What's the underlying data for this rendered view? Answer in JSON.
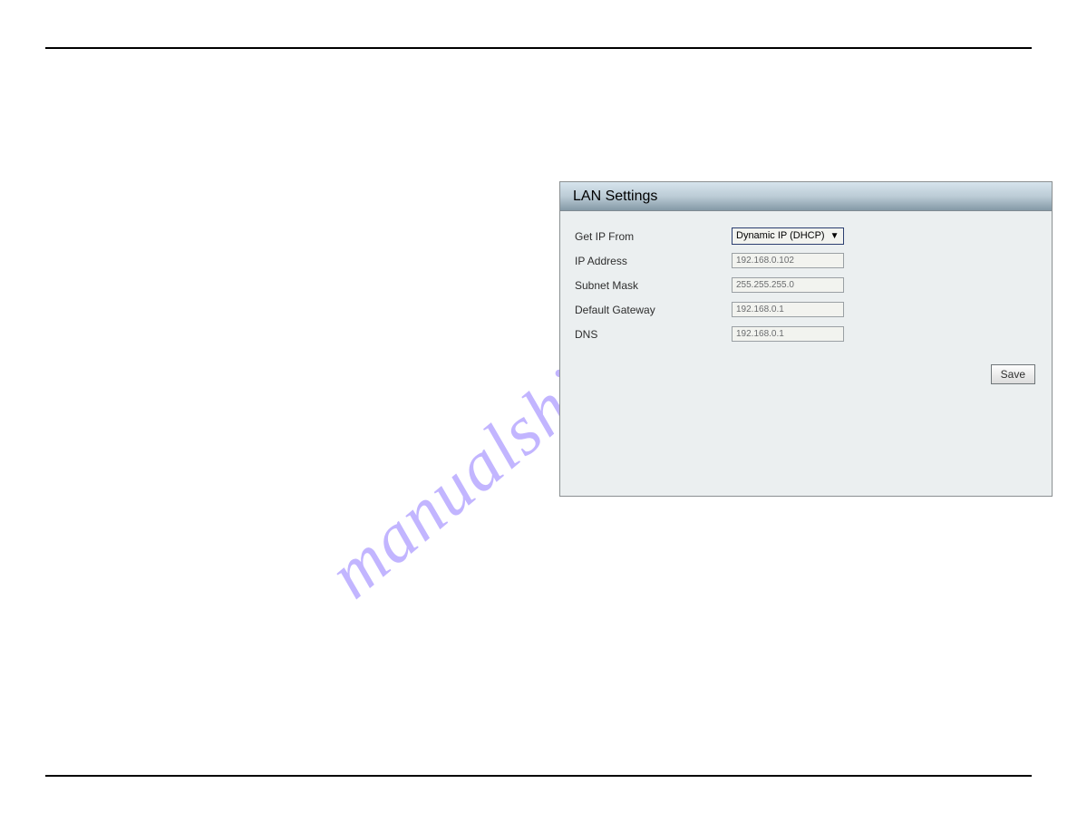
{
  "watermark": "manualshive.com",
  "panel": {
    "title": "LAN Settings",
    "fields": {
      "get_ip_from": {
        "label": "Get IP From",
        "value": "Dynamic IP (DHCP)"
      },
      "ip_address": {
        "label": "IP Address",
        "value": "192.168.0.102"
      },
      "subnet_mask": {
        "label": "Subnet Mask",
        "value": "255.255.255.0"
      },
      "gateway": {
        "label": "Default Gateway",
        "value": "192.168.0.1"
      },
      "dns": {
        "label": "DNS",
        "value": "192.168.0.1"
      }
    },
    "save_label": "Save"
  }
}
